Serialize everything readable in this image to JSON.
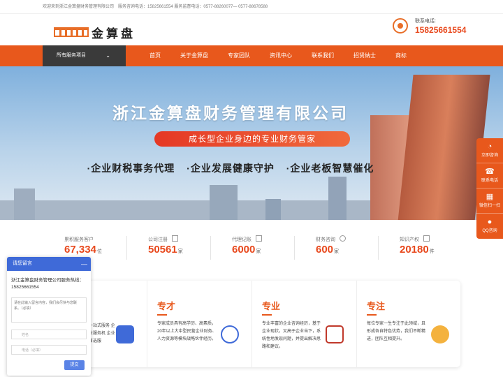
{
  "topbar": {
    "text": "欢迎来到浙江金算盘财务管理有限公司　服务咨询电话：15825661554 服务监督电话：0577-88260077— 0577-88678588"
  },
  "header": {
    "logo_text": "金算盘",
    "contact_label": "联系电话:",
    "contact_number": "15825661554"
  },
  "nav": {
    "all_services": "所有服务项目",
    "items": [
      "首页",
      "关于金算盘",
      "专家团队",
      "资讯中心",
      "联系我们",
      "招贤纳士",
      "商标"
    ]
  },
  "banner": {
    "title": "浙江金算盘财务管理有限公司",
    "slogan": "成长型企业身边的专业财务管家",
    "bullets": [
      "·企业财税事务代理",
      "·企业发展健康守护",
      "·企业老板智慧催化"
    ]
  },
  "stats": [
    {
      "label": "累积服务客户",
      "value": "67,334",
      "unit": "位"
    },
    {
      "label": "公司注册",
      "value": "50561",
      "unit": "家"
    },
    {
      "label": "代理记账",
      "value": "6000",
      "unit": "家"
    },
    {
      "label": "财务咨询",
      "value": "600",
      "unit": "家"
    },
    {
      "label": "知识产权",
      "value": "20180",
      "unit": "件"
    }
  ],
  "cards": [
    {
      "title": "",
      "text": "一站式服务 企业服务机 企业首选服"
    },
    {
      "title": "专才",
      "text": "专家成员具有高学历、高素质，20年以上大中型民营企业财务、人力资源等模块战略伙伴经历。"
    },
    {
      "title": "专业",
      "text": "专业丰富的企业咨询经历，基于企业现状，又高于企业当下，系统性地发现问题，并提出解决思路和建议。"
    },
    {
      "title": "专注",
      "text": "每位专家一生专注于此领域，且形成各自特色优势，我们不断精进，团队互相提升。"
    }
  ],
  "chat": {
    "title": "请您留言",
    "intro": "浙江金算盘财务管理公司服务热线：15825661554",
    "placeholder": "请在此输入留言内容，我们会尽快与您联系。（必填）",
    "name_placeholder": "姓名",
    "phone_placeholder": "电话（必填）",
    "submit": "提交"
  },
  "side": [
    {
      "icon": "consult-icon",
      "label": "立即咨询"
    },
    {
      "icon": "phone-icon",
      "label": "联系电话"
    },
    {
      "icon": "wechat-icon",
      "label": "微信扫一扫"
    },
    {
      "icon": "qq-icon",
      "label": "QQ咨询"
    }
  ],
  "colors": {
    "accent": "#e8581c",
    "dark": "#3a3a3a",
    "chat": "#3f6ad8"
  }
}
